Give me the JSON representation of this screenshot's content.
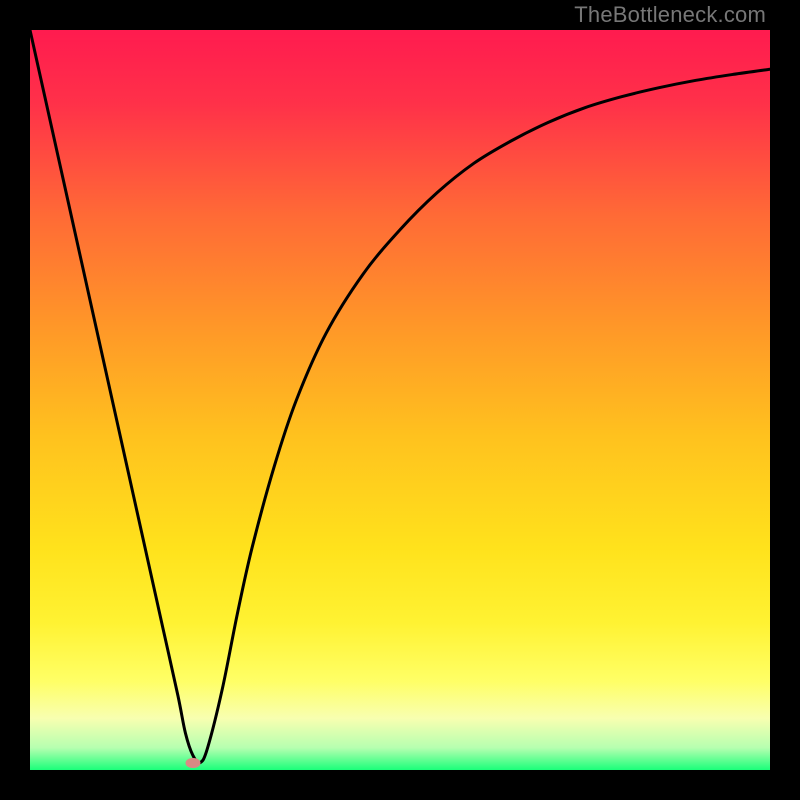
{
  "watermark": "TheBottleneck.com",
  "chart_data": {
    "type": "line",
    "title": "",
    "xlabel": "",
    "ylabel": "",
    "xlim": [
      0,
      100
    ],
    "ylim": [
      0,
      100
    ],
    "gradient_stops": [
      {
        "pos": 0.0,
        "color": "#ff1b4f"
      },
      {
        "pos": 0.1,
        "color": "#ff3149"
      },
      {
        "pos": 0.25,
        "color": "#ff6a36"
      },
      {
        "pos": 0.4,
        "color": "#ff9728"
      },
      {
        "pos": 0.55,
        "color": "#ffc21e"
      },
      {
        "pos": 0.7,
        "color": "#ffe21c"
      },
      {
        "pos": 0.8,
        "color": "#fff232"
      },
      {
        "pos": 0.88,
        "color": "#ffff66"
      },
      {
        "pos": 0.93,
        "color": "#f8ffb0"
      },
      {
        "pos": 0.97,
        "color": "#b6ffb0"
      },
      {
        "pos": 1.0,
        "color": "#1aff7a"
      }
    ],
    "series": [
      {
        "name": "bottleneck-curve",
        "x": [
          0,
          2,
          4,
          6,
          8,
          10,
          12,
          14,
          16,
          18,
          20,
          21,
          22,
          23,
          24,
          26,
          28,
          30,
          33,
          36,
          40,
          45,
          50,
          55,
          60,
          65,
          70,
          75,
          80,
          85,
          90,
          95,
          100
        ],
        "values": [
          100,
          91,
          82,
          73,
          64,
          55,
          46,
          37,
          28,
          19,
          10,
          5,
          2,
          1,
          3,
          11,
          21,
          30,
          41,
          50,
          59,
          67,
          73,
          78,
          82,
          85,
          87.5,
          89.5,
          91,
          92.2,
          93.2,
          94,
          94.7
        ]
      }
    ],
    "marker": {
      "x": 22,
      "y": 1
    }
  }
}
